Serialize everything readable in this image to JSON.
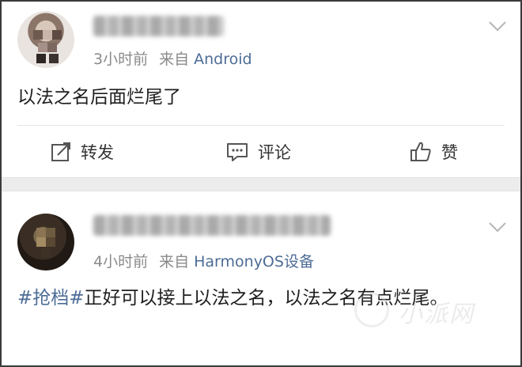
{
  "posts": [
    {
      "time": "3小时前",
      "via": "来自",
      "source": "Android",
      "text": "以法之名后面烂尾了",
      "actions": {
        "repost": "转发",
        "comment": "评论",
        "like": "赞"
      }
    },
    {
      "time": "4小时前",
      "via": "来自",
      "source": "HarmonyOS设备",
      "hashtag": "#抢档#",
      "text": "正好可以接上以法之名，以法之名有点烂尾。"
    }
  ],
  "colors": {
    "link": "#4d6c96",
    "meta": "#8a8a8a",
    "text": "#1e1e1e",
    "separator": "#ececec"
  }
}
